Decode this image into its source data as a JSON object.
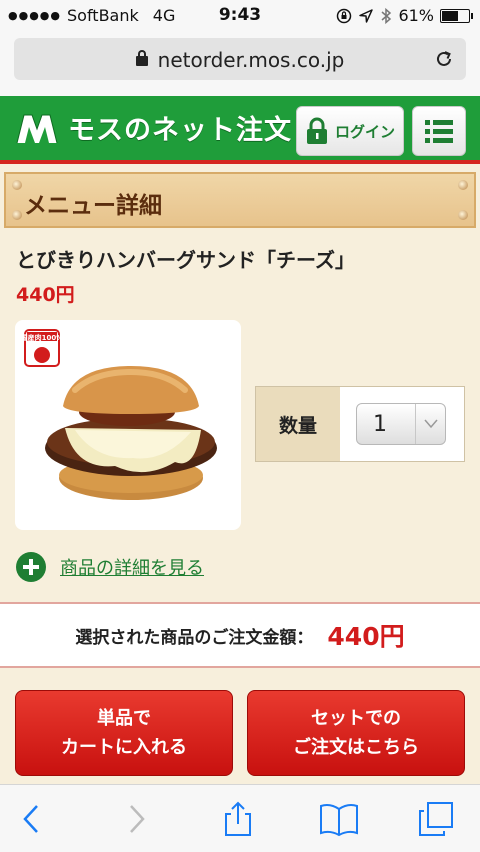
{
  "status_bar": {
    "carrier": "SoftBank",
    "network": "4G",
    "time": "9:43",
    "battery_text": "61%",
    "battery_level": 0.61
  },
  "browser": {
    "url": "netorder.mos.co.jp"
  },
  "header": {
    "logo_text": "モスのネット注文",
    "login_label": "ログイン"
  },
  "section": {
    "title": "メニュー詳細"
  },
  "product": {
    "name": "とびきりハンバーグサンド「チーズ」",
    "price": "440円",
    "badge_text": "国産肉100%",
    "quantity_label": "数量",
    "quantity_value": "1",
    "detail_link": "商品の詳細を見る"
  },
  "total": {
    "label": "選択された商品のご注文金額：",
    "value": "440円"
  },
  "buttons": {
    "single_line1": "単品で",
    "single_line2": "カートに入れる",
    "set_line1": "セットでの",
    "set_line2": "ご注文はこちら"
  },
  "colors": {
    "brand_green": "#1f9d3a",
    "accent_red": "#d21c1c",
    "link_green": "#1f7e33"
  }
}
